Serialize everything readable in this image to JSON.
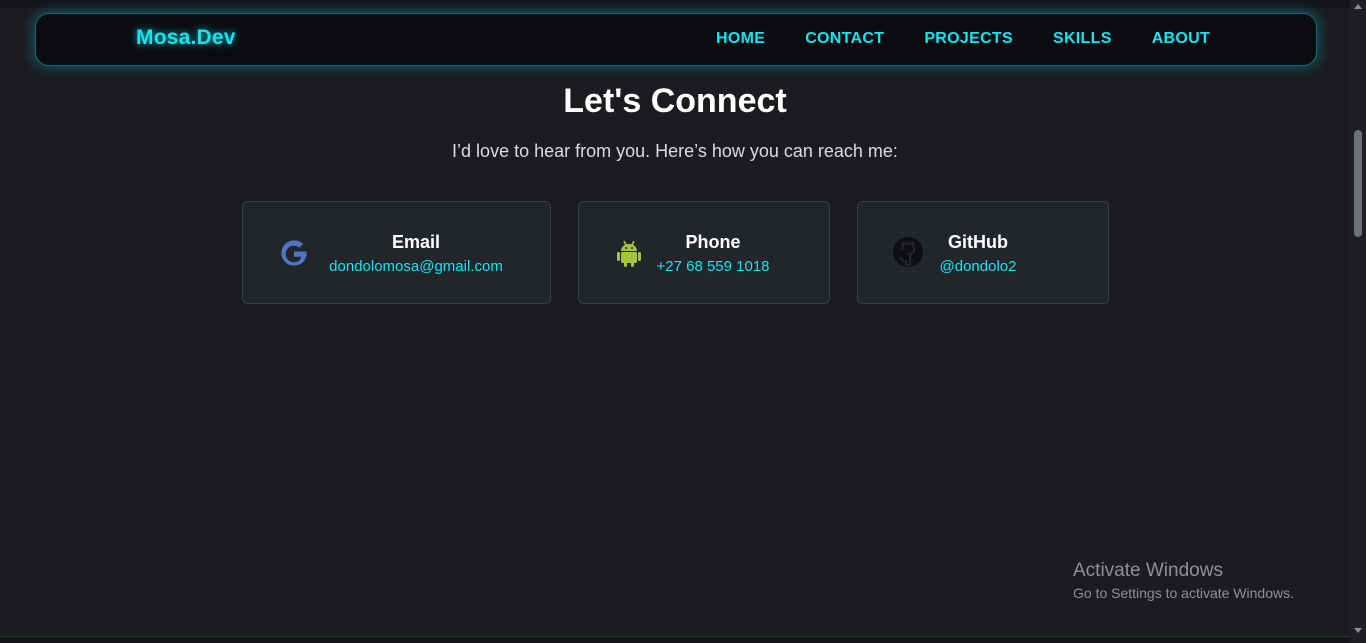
{
  "nav": {
    "brand": "Mosa.Dev",
    "links": [
      "HOME",
      "CONTACT",
      "PROJECTS",
      "SKILLS",
      "ABOUT"
    ]
  },
  "contact": {
    "title": "Let's Connect",
    "subtitle": "I’d love to hear from you. Here’s how you can reach me:",
    "cards": [
      {
        "label": "Email",
        "value": "dondolomosa@gmail.com",
        "icon": "google-icon"
      },
      {
        "label": "Phone",
        "value": "+27 68 559 1018",
        "icon": "android-icon"
      },
      {
        "label": "GitHub",
        "value": "@dondolo2",
        "icon": "github-icon"
      }
    ]
  },
  "watermark": {
    "title": "Activate Windows",
    "subtitle": "Go to Settings to activate Windows."
  },
  "colors": {
    "accent": "#12e6f2",
    "background": "#1b1c20",
    "card": "#22252a",
    "google_blue": "#4f76c4",
    "android_green": "#a4c639"
  }
}
